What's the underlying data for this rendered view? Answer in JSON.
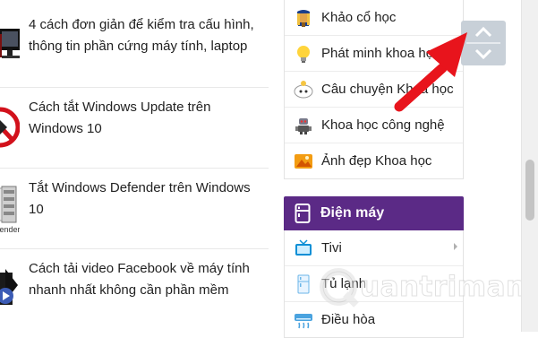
{
  "articles": [
    {
      "title": "4 cách đơn giản để kiểm tra cấu hình, thông tin phần cứng máy tính, laptop",
      "thumb_icon": "computer-monitor-icon"
    },
    {
      "title": "Cách tắt Windows Update trên Windows 10",
      "thumb_icon": "prohibited-icon"
    },
    {
      "title": "Tắt Windows Defender trên Windows 10",
      "thumb_icon": "windows-defender-icon",
      "thumb_caption": "efender"
    },
    {
      "title": "Cách tải video Facebook về máy tính nhanh nhất không cần phần mềm",
      "thumb_icon": "video-download-icon"
    }
  ],
  "science_menu": [
    {
      "label": "Khảo cổ học",
      "icon": "pharaoh-icon"
    },
    {
      "label": "Phát minh khoa học",
      "icon": "lightbulb-icon"
    },
    {
      "label": "Câu chuyện Khoa học",
      "icon": "cloud-icon"
    },
    {
      "label": "Khoa học công nghệ",
      "icon": "robot-icon"
    },
    {
      "label": "Ảnh đẹp Khoa học",
      "icon": "image-icon"
    }
  ],
  "appliance_category": {
    "title": "Điện máy",
    "icon": "fridge-icon",
    "items": [
      {
        "label": "Tivi",
        "icon": "tv-icon",
        "has_submenu": true
      },
      {
        "label": "Tủ lạnh",
        "icon": "fridge-small-icon"
      },
      {
        "label": "Điều hòa",
        "icon": "air-conditioner-icon"
      }
    ]
  },
  "watermark": {
    "text": "uantrimang"
  },
  "colors": {
    "category_header": "#5b2a86",
    "annotation_arrow": "#e8141c",
    "scroll_widget": "#c8d0d8"
  }
}
